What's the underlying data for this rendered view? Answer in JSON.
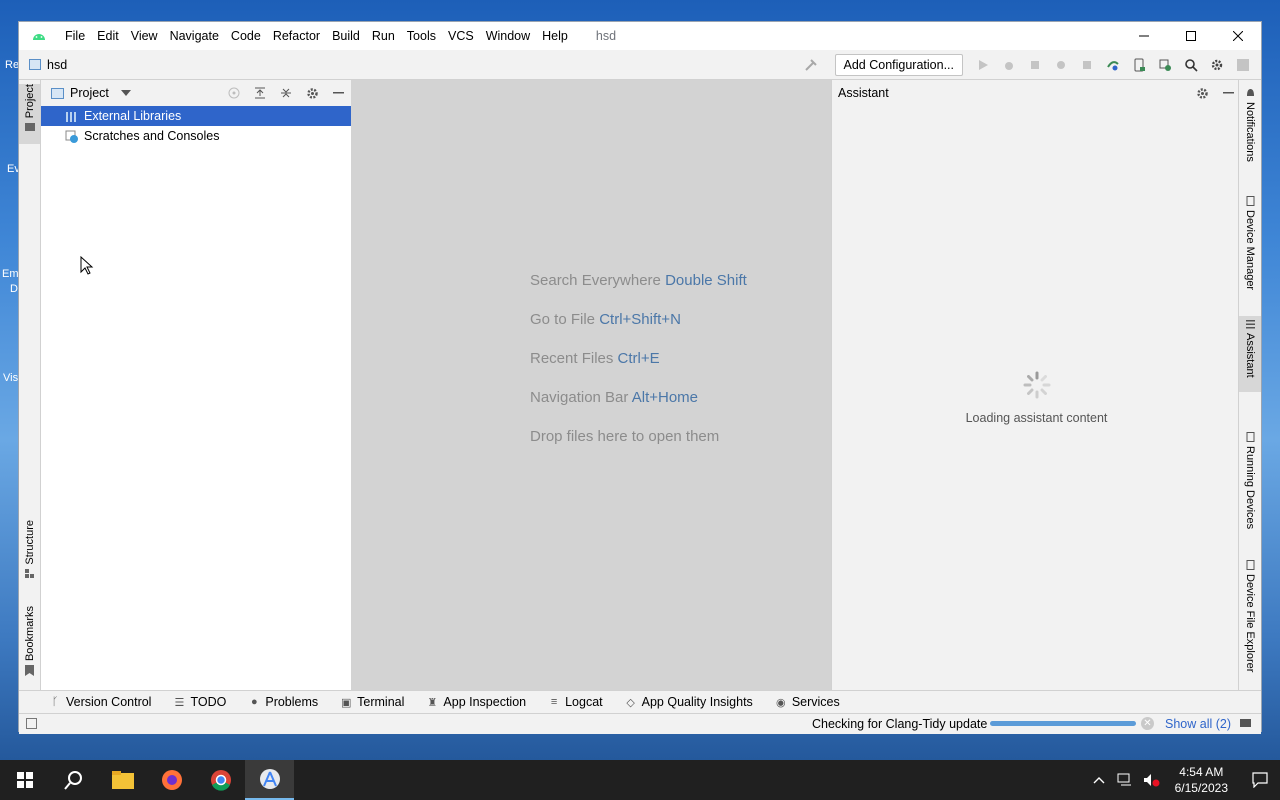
{
  "desktop": {
    "frag1": "Re",
    "frag2": "Ev",
    "frag3": "Em",
    "frag4": "D",
    "frag5": "Vis"
  },
  "window": {
    "menu": [
      "File",
      "Edit",
      "View",
      "Navigate",
      "Code",
      "Refactor",
      "Build",
      "Run",
      "Tools",
      "VCS",
      "Window",
      "Help"
    ],
    "title": "hsd"
  },
  "navbar": {
    "project": "hsd",
    "add_configuration": "Add Configuration..."
  },
  "left_strip": {
    "project": "Project",
    "structure": "Structure",
    "bookmarks": "Bookmarks"
  },
  "project_panel": {
    "title": "Project",
    "items": [
      {
        "label": "External Libraries",
        "selected": true
      },
      {
        "label": "Scratches and Consoles",
        "selected": false
      }
    ]
  },
  "editor": {
    "hints": [
      {
        "text": "Search Everywhere",
        "key": "Double Shift"
      },
      {
        "text": "Go to File",
        "key": "Ctrl+Shift+N"
      },
      {
        "text": "Recent Files",
        "key": "Ctrl+E"
      },
      {
        "text": "Navigation Bar",
        "key": "Alt+Home"
      },
      {
        "text": "Drop files here to open them",
        "key": ""
      }
    ]
  },
  "assistant": {
    "title": "Assistant",
    "loading": "Loading assistant content"
  },
  "right_strip": {
    "notifications": "Notifications",
    "device_manager": "Device Manager",
    "assistant": "Assistant",
    "running_devices": "Running Devices",
    "device_file_explorer": "Device File Explorer"
  },
  "bottom_tabs": [
    "Version Control",
    "TODO",
    "Problems",
    "Terminal",
    "App Inspection",
    "Logcat",
    "App Quality Insights",
    "Services"
  ],
  "status": {
    "text": "Checking for Clang-Tidy update",
    "progress": 1.0,
    "show_all": "Show all (2)"
  },
  "taskbar": {
    "time": "4:54 AM",
    "date": "6/15/2023"
  },
  "colors": {
    "selection": "#2f65ca",
    "editor_bg": "#d3d3d3",
    "hint_key": "#4b77a8"
  }
}
